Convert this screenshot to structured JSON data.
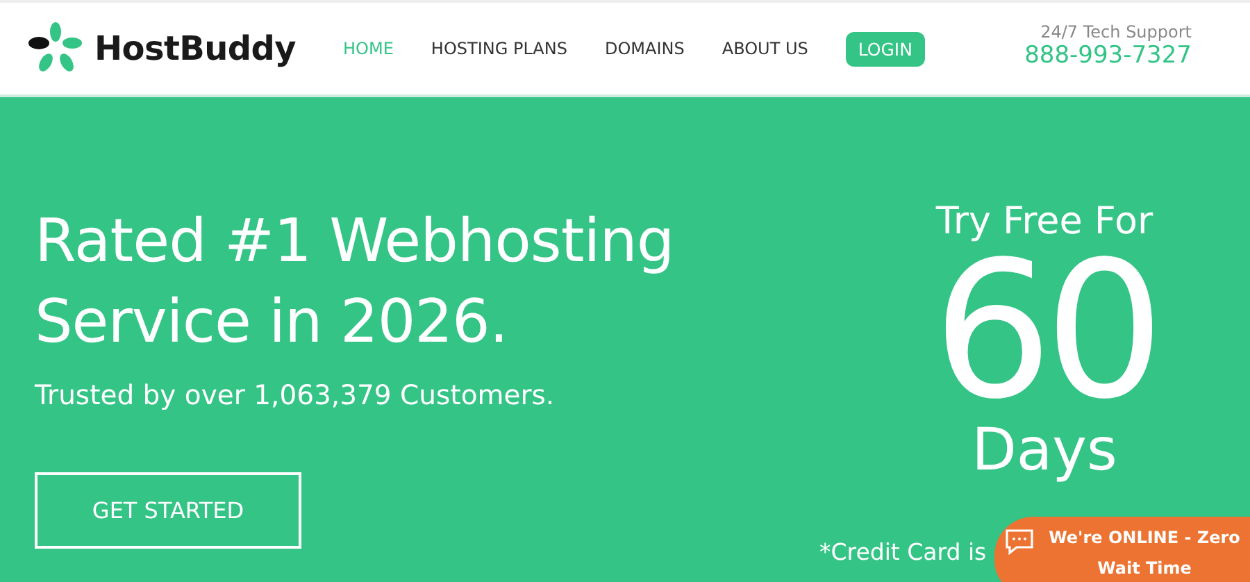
{
  "logo": {
    "text": "HostBuddy"
  },
  "nav": [
    {
      "label": "HOME",
      "selected": true
    },
    {
      "label": "HOSTING PLANS",
      "selected": false
    },
    {
      "label": "DOMAINS",
      "selected": false
    },
    {
      "label": "ABOUT US",
      "selected": false
    }
  ],
  "login": {
    "label": "LOGIN"
  },
  "support": {
    "label": "24/7 Tech Support",
    "phone": "888-993-7327"
  },
  "hero": {
    "headline": "Rated #1 Webhosting Service in 2026.",
    "subline": "Trusted by over 1,063,379 Customers.",
    "cta": "GET STARTED",
    "offer_top": "Try Free For",
    "offer_number": "60",
    "offer_bottom": "Days",
    "note": "*Credit Card is"
  },
  "chat": {
    "text": "We're ONLINE - Zero Wait Time"
  }
}
